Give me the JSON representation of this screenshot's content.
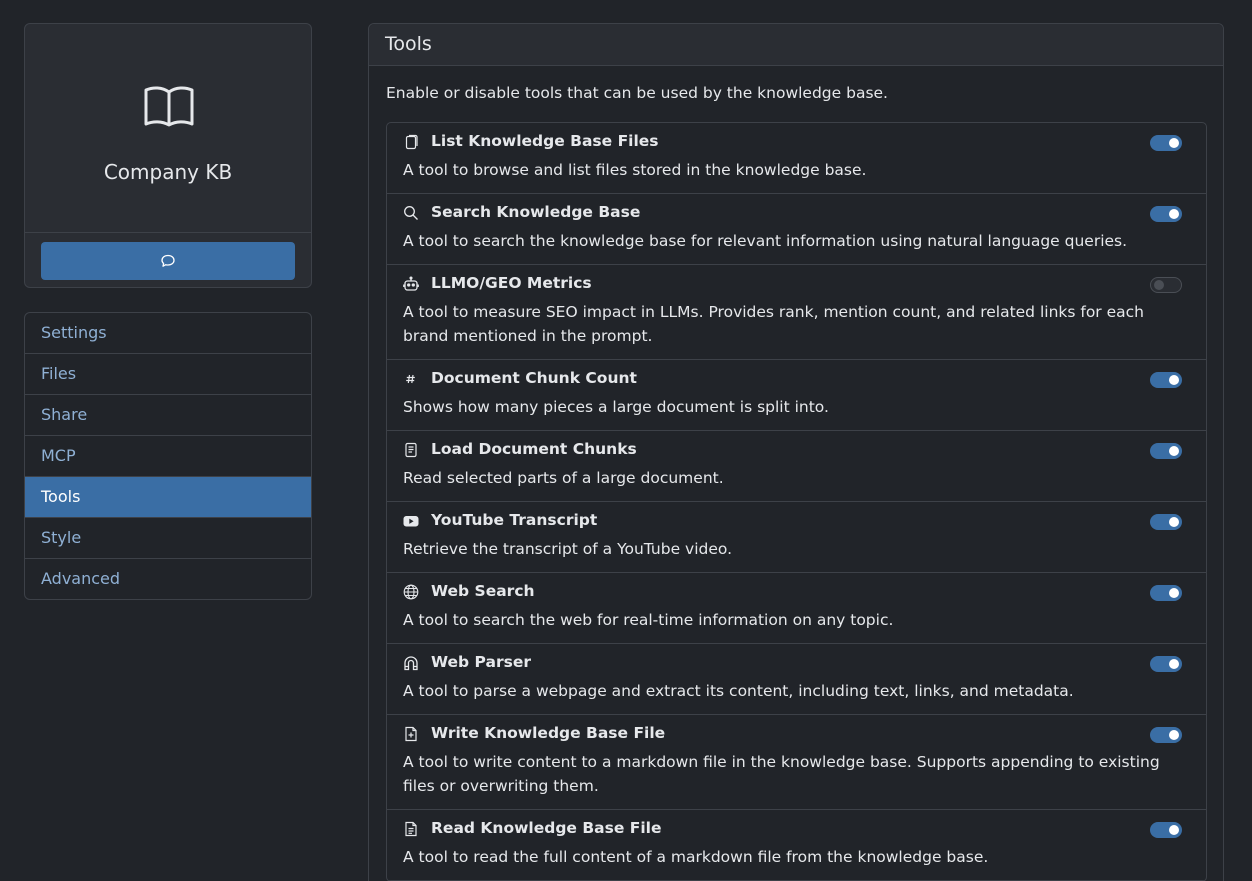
{
  "sidebar": {
    "kb_name": "Company KB",
    "icon": "book-open-icon",
    "chat_button_icon": "chat-bubble-icon",
    "nav": [
      {
        "label": "Settings",
        "active": false
      },
      {
        "label": "Files",
        "active": false
      },
      {
        "label": "Share",
        "active": false
      },
      {
        "label": "MCP",
        "active": false
      },
      {
        "label": "Tools",
        "active": true
      },
      {
        "label": "Style",
        "active": false
      },
      {
        "label": "Advanced",
        "active": false
      }
    ]
  },
  "main": {
    "title": "Tools",
    "description": "Enable or disable tools that can be used by the knowledge base.",
    "tools": [
      {
        "title": "List Knowledge Base Files",
        "icon": "files-icon",
        "description": "A tool to browse and list files stored in the knowledge base.",
        "enabled": true
      },
      {
        "title": "Search Knowledge Base",
        "icon": "search-icon",
        "description": "A tool to search the knowledge base for relevant information using natural language queries.",
        "enabled": true
      },
      {
        "title": "LLMO/GEO Metrics",
        "icon": "robot-icon",
        "description": "A tool to measure SEO impact in LLMs. Provides rank, mention count, and related links for each brand mentioned in the prompt.",
        "enabled": false
      },
      {
        "title": "Document Chunk Count",
        "icon": "hash-icon",
        "description": "Shows how many pieces a large document is split into.",
        "enabled": true
      },
      {
        "title": "Load Document Chunks",
        "icon": "document-icon",
        "description": "Read selected parts of a large document.",
        "enabled": true
      },
      {
        "title": "YouTube Transcript",
        "icon": "youtube-icon",
        "description": "Retrieve the transcript of a YouTube video.",
        "enabled": true
      },
      {
        "title": "Web Search",
        "icon": "globe-icon",
        "description": "A tool to search the web for real-time information on any topic.",
        "enabled": true
      },
      {
        "title": "Web Parser",
        "icon": "magnet-icon",
        "description": "A tool to parse a webpage and extract its content, including text, links, and metadata.",
        "enabled": true
      },
      {
        "title": "Write Knowledge Base File",
        "icon": "file-plus-icon",
        "description": "A tool to write content to a markdown file in the knowledge base. Supports appending to existing files or overwriting them.",
        "enabled": true
      },
      {
        "title": "Read Knowledge Base File",
        "icon": "file-text-icon",
        "description": "A tool to read the full content of a markdown file from the knowledge base.",
        "enabled": true
      }
    ]
  },
  "colors": {
    "background": "#212429",
    "card": "#2a2d33",
    "border": "#3d4148",
    "accent": "#3a6ea5",
    "nav_text": "#8fb0d4"
  }
}
